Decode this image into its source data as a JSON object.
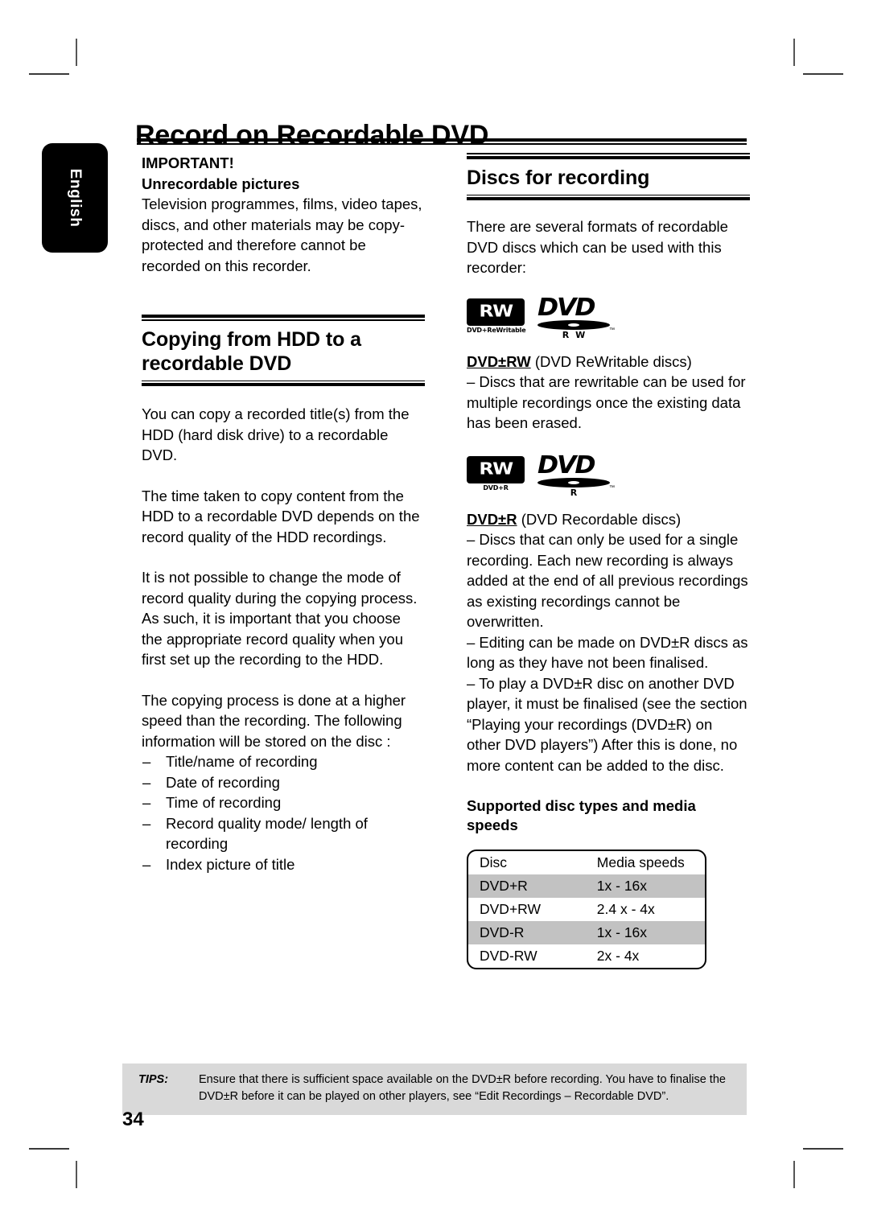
{
  "page": {
    "title": "Record on Recordable DVD",
    "number": "34",
    "language_tab": "English"
  },
  "left_column": {
    "important_label": "IMPORTANT!",
    "important_subhead": "Unrecordable pictures",
    "important_body": "Television programmes, films, video tapes, discs, and other materials may be copy-protected and therefore cannot be recorded on this recorder.",
    "section_heading": "Copying from HDD to a recordable DVD",
    "paragraphs": [
      "You can copy a recorded title(s) from the HDD (hard disk drive) to a recordable DVD.",
      "The time taken to copy content from the HDD to a recordable DVD depends on the record quality of the HDD recordings.",
      "It is not possible to change the mode of record quality during the copying process. As such, it is important that you choose the appropriate record quality when you first set up the recording to the HDD.",
      "The copying process is done at a higher speed than the recording. The following information will be stored on the disc :"
    ],
    "stored_info_items": [
      "Title/name of recording",
      "Date of recording",
      "Time of recording",
      "Record quality mode/ length of recording",
      "Index picture of title"
    ],
    "list_dash": "–"
  },
  "right_column": {
    "section_heading": "Discs for recording",
    "intro": "There are several formats of recordable DVD discs which can be used with this recorder:",
    "formats": [
      {
        "logo": {
          "rw_text": "RW",
          "rw_caption": "DVD+ReWritable",
          "dvd_word": "DVD",
          "dvd_sub": "R W",
          "tm": "™"
        },
        "term": "DVD±RW",
        "term_suffix": " (DVD ReWritable discs)",
        "body": "– Discs that are rewritable can be used for multiple recordings once the existing data has been erased."
      },
      {
        "logo": {
          "rw_text": "RW",
          "rw_caption": "DVD+R",
          "dvd_word": "DVD",
          "dvd_sub": "R",
          "tm": "™"
        },
        "term": "DVD±R",
        "term_suffix": " (DVD Recordable discs)",
        "body": "– Discs that can only be used for a single recording. Each new recording is always added at the end of all previous recordings as existing recordings cannot be overwritten.",
        "body2": "– Editing can be made on DVD±R discs as long as they have not been finalised.",
        "body3": "– To play a DVD±R disc on another DVD player, it must be finalised (see the section “Playing your recordings (DVD±R) on other DVD players”) After this is done, no more content can be added to the disc."
      }
    ],
    "table_heading": "Supported disc types and media speeds",
    "table": {
      "columns": [
        "Disc",
        "Media speeds"
      ],
      "rows": [
        {
          "disc": "DVD+R",
          "speed": "1x - 16x",
          "shaded": true
        },
        {
          "disc": "DVD+RW",
          "speed": "2.4 x - 4x",
          "shaded": false
        },
        {
          "disc": "DVD-R",
          "speed": "1x - 16x",
          "shaded": true
        },
        {
          "disc": "DVD-RW",
          "speed": "2x - 4x",
          "shaded": false
        }
      ]
    }
  },
  "footer": {
    "tips_label": "TIPS:",
    "tips_text": "Ensure that there is sufficient space available on the DVD±R before recording. You have to finalise the DVD±R before it can be played on other players, see “Edit Recordings – Recordable DVD”."
  }
}
